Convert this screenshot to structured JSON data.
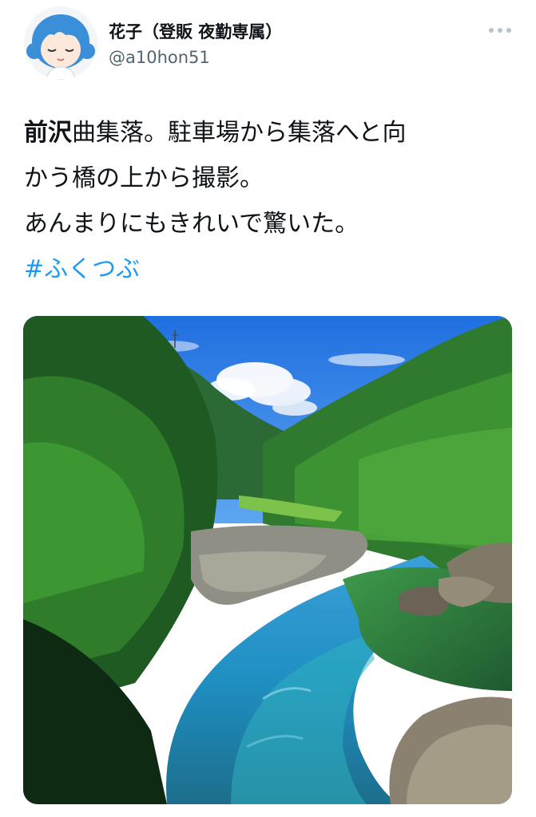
{
  "user": {
    "display_name": "花子（登販 夜勤専属）",
    "handle": "@a10hon51"
  },
  "tweet": {
    "text_bold": "前沢",
    "text_line1_rest": "曲集落。駐車場から集落へと向",
    "text_line2": "かう橋の上から撮影。",
    "text_line3": "あんまりにもきれいで驚いた。",
    "hashtag": "#ふくつぶ"
  },
  "colors": {
    "hashtag": "#1d9bf0",
    "handle": "#536471",
    "text": "#0f1419"
  },
  "icons": {
    "more": "more-horizontal-icon",
    "avatar": "cartoon-girl-avatar"
  }
}
